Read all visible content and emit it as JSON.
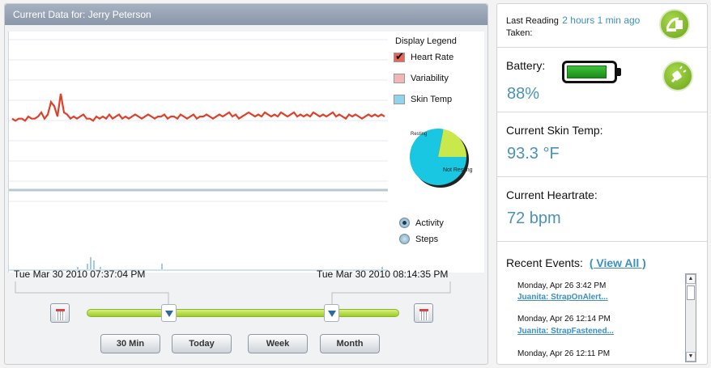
{
  "header": {
    "title": "Current Data for:  Jerry Peterson"
  },
  "chart": {
    "start_label": "Tue Mar 30 2010 07:37:04 PM",
    "end_label": "Tue Mar 30 2010 08:14:35 PM"
  },
  "legend": {
    "title": "Display Legend",
    "items": [
      {
        "label": "Heart Rate",
        "color": "#e8655a",
        "checked": true
      },
      {
        "label": "Variability",
        "color": "#f2b6b4",
        "checked": false
      },
      {
        "label": "Skin Temp",
        "color": "#8fd3ee",
        "checked": false
      }
    ]
  },
  "pie": {
    "resting_label": "Resting",
    "not_resting_label": "Not Resting"
  },
  "lower_legend": [
    {
      "label": "Activity",
      "selected": true
    },
    {
      "label": "Steps",
      "selected": false
    }
  ],
  "range_buttons": [
    "30 Min",
    "Today",
    "Week",
    "Month"
  ],
  "status": {
    "last_reading_label": "Last Reading",
    "last_reading_value": "2 hours 1 min ago",
    "taken_label": "Taken:",
    "battery_label": "Battery:",
    "battery_value": "88%",
    "skin_temp_label": "Current Skin Temp:",
    "skin_temp_value": "93.3 °F",
    "heartrate_label": "Current Heartrate:",
    "heartrate_value": "72 bpm",
    "recent_events_label": "Recent Events:",
    "view_all_label": "( View All )"
  },
  "events": [
    {
      "time": "Monday, Apr 26 3:42 PM",
      "link": "Juanita: StrapOnAlert..."
    },
    {
      "time": "Monday, Apr 26 12:14 PM",
      "link": "Juanita: StrapFastened..."
    },
    {
      "time": "Monday, Apr 26 12:11 PM",
      "link": ""
    }
  ],
  "chart_data": {
    "type": "line",
    "series": [
      {
        "name": "Heart Rate",
        "values": [
          72,
          71,
          72,
          72,
          71,
          73,
          72,
          72,
          73,
          75,
          72,
          74,
          80,
          78,
          73,
          84,
          75,
          74,
          72,
          73,
          72,
          73,
          74,
          72,
          72,
          71,
          73,
          72,
          73,
          72,
          74,
          72,
          73,
          74,
          72,
          73,
          72,
          73,
          74,
          73,
          72,
          73,
          74,
          73,
          72,
          73,
          73,
          74,
          72,
          73,
          73,
          72,
          74,
          73,
          72,
          73,
          74,
          72,
          73,
          73,
          74,
          73,
          72,
          73,
          74,
          73,
          74,
          75,
          73,
          74,
          72,
          73,
          74,
          75,
          74,
          73,
          74,
          73,
          75,
          74,
          73,
          74,
          73,
          75,
          74,
          73,
          74,
          75,
          73,
          74,
          73,
          74,
          73,
          75,
          74,
          73,
          74,
          73,
          74,
          75,
          73,
          74,
          73,
          72,
          74,
          73,
          74,
          73,
          72,
          73,
          74,
          73,
          74,
          73,
          74,
          73
        ]
      }
    ],
    "activity": [
      0,
      0,
      0,
      0,
      0,
      0,
      0,
      0,
      0,
      0,
      0,
      0,
      0,
      0,
      0,
      0,
      0,
      0,
      0,
      0,
      1,
      0,
      0,
      2,
      4,
      3,
      0,
      1,
      0,
      0,
      0,
      0,
      0,
      0,
      0,
      0,
      0,
      0,
      0,
      0,
      0,
      0,
      0,
      0,
      0,
      0,
      2,
      0,
      0,
      0,
      0,
      0,
      0,
      0,
      0,
      0,
      0,
      0,
      0,
      0,
      0,
      0,
      0,
      0,
      0,
      0,
      0,
      0,
      0,
      0,
      0,
      0,
      0,
      0,
      0,
      0,
      0,
      0,
      0,
      0,
      0,
      0,
      0,
      0,
      0,
      0,
      0,
      0,
      0,
      0,
      0,
      0,
      0,
      0,
      0,
      0,
      0,
      0,
      0,
      0,
      0,
      0,
      0,
      0,
      0,
      0,
      0,
      0,
      0,
      0,
      0,
      0,
      0,
      0,
      1,
      0
    ],
    "pie": [
      {
        "label": "Resting",
        "value": 78
      },
      {
        "label": "Not Resting",
        "value": 22
      }
    ]
  }
}
